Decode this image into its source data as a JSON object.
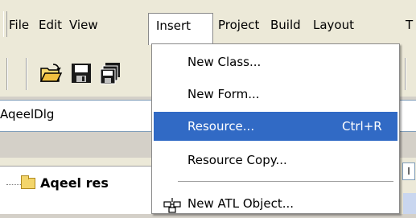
{
  "menubar": {
    "items": [
      {
        "label": "File"
      },
      {
        "label": "Edit"
      },
      {
        "label": "View"
      },
      {
        "label": "Insert"
      },
      {
        "label": "Project"
      },
      {
        "label": "Build"
      },
      {
        "label": "Layout"
      },
      {
        "label": "T"
      }
    ]
  },
  "classbox": {
    "value": "AqeelDlg"
  },
  "tree": {
    "root_label": "Aqeel res"
  },
  "strip_right": {
    "text": "I"
  },
  "insert_menu": {
    "items": [
      {
        "label": "New Class..."
      },
      {
        "label": "New Form..."
      },
      {
        "label": "Resource...",
        "shortcut": "Ctrl+R"
      },
      {
        "label": "Resource Copy..."
      },
      {
        "label": "New ATL Object..."
      }
    ]
  },
  "colors": {
    "menu_highlight": "#316ac5",
    "menubar_bg": "#ece9d8",
    "window_bg": "#d4d0c8"
  }
}
